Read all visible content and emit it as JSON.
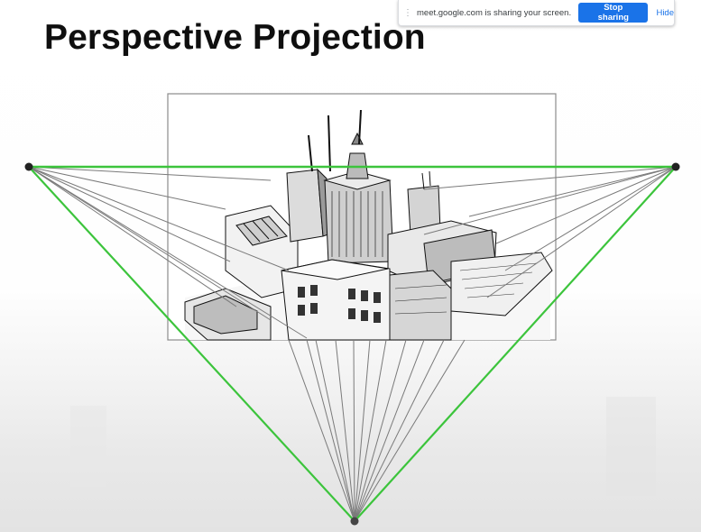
{
  "slide": {
    "title": "Perspective Projection"
  },
  "share_bar": {
    "message": "meet.google.com is sharing your screen.",
    "stop_label": "Stop sharing",
    "hide_label": "Hide",
    "drag_icon": "drag-handle-icon"
  },
  "colors": {
    "horizon_line": "#3cc43c",
    "projector_lines": "#7a7a7a",
    "picture_frame": "#8c8c8c",
    "accent": "#1a73e8"
  }
}
